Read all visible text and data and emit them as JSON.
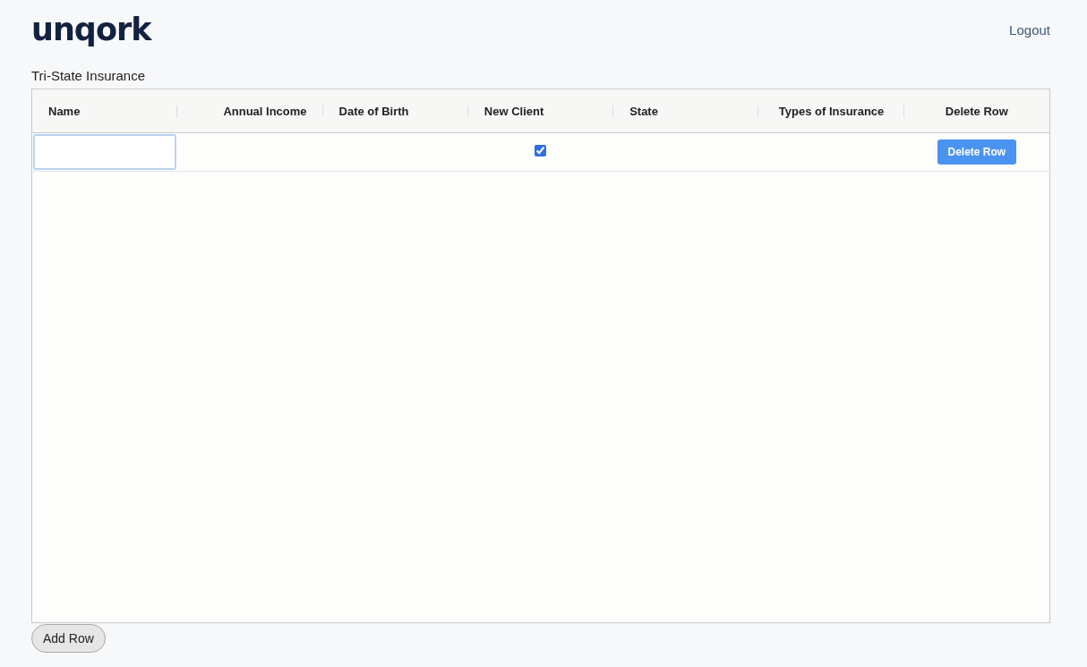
{
  "header": {
    "logo": "unqork",
    "logout": "Logout"
  },
  "grid": {
    "title": "Tri-State Insurance",
    "columns": [
      {
        "label": "Name",
        "kind": "text"
      },
      {
        "label": "Annual Income",
        "kind": "number"
      },
      {
        "label": "Date of Birth",
        "kind": "date"
      },
      {
        "label": "New Client",
        "kind": "checkbox"
      },
      {
        "label": "State",
        "kind": "select"
      },
      {
        "label": "Types of Insurance",
        "kind": "multiselect"
      },
      {
        "label": "Delete Row",
        "kind": "action"
      }
    ],
    "rows": [
      {
        "name_focused": true,
        "new_client_checked": true,
        "delete_label": "Delete Row"
      }
    ]
  },
  "add_button": "Add Row"
}
